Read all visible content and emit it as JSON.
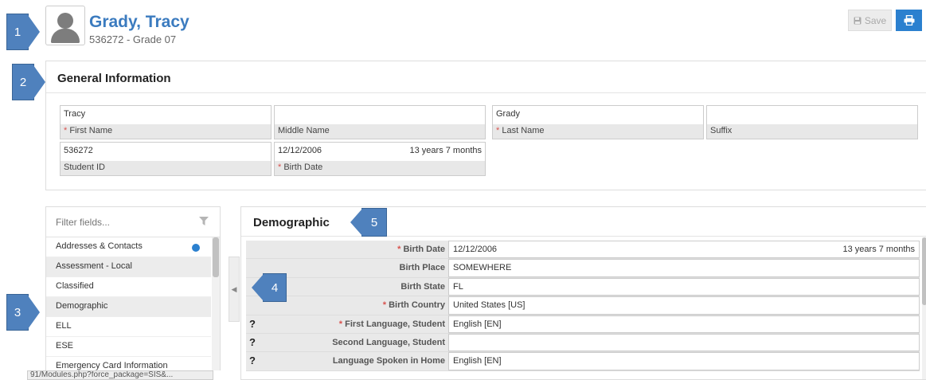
{
  "student": {
    "name": "Grady, Tracy",
    "subtitle": "536272 - Grade 07"
  },
  "toolbar": {
    "save_label": "Save"
  },
  "callouts": [
    "1",
    "2",
    "3",
    "4",
    "5"
  ],
  "general": {
    "title": "General Information",
    "fields": {
      "first_name": {
        "value": "Tracy",
        "label": "First Name"
      },
      "middle_name": {
        "value": "",
        "label": "Middle Name"
      },
      "last_name": {
        "value": "Grady",
        "label": "Last Name"
      },
      "suffix": {
        "value": "",
        "label": "Suffix"
      },
      "student_id": {
        "value": "536272",
        "label": "Student ID"
      },
      "birth_date": {
        "value": "12/12/2006",
        "age": "13 years 7 months",
        "label": "Birth Date"
      }
    }
  },
  "sidebar": {
    "filter_placeholder": "Filter fields...",
    "items": [
      {
        "label": "Addresses & Contacts"
      },
      {
        "label": "Assessment - Local"
      },
      {
        "label": "Classified"
      },
      {
        "label": "Demographic"
      },
      {
        "label": "ELL"
      },
      {
        "label": "ESE"
      },
      {
        "label": "Emergency Card Information"
      }
    ]
  },
  "status_url": "91/Modules.php?force_package=SIS&...",
  "demographic": {
    "title": "Demographic",
    "rows": [
      {
        "label": "Birth Date",
        "value": "12/12/2006",
        "extra": "13 years 7 months"
      },
      {
        "label": "Birth Place",
        "value": "SOMEWHERE"
      },
      {
        "label": "Birth State",
        "value": "FL"
      },
      {
        "label": "Birth Country",
        "value": "United States [US]"
      },
      {
        "label": "First Language, Student",
        "value": "English [EN]"
      },
      {
        "label": "Second Language, Student",
        "value": ""
      },
      {
        "label": "Language Spoken in Home",
        "value": "English [EN]"
      }
    ]
  },
  "colors": {
    "accent": "#2b80cf",
    "name": "#3b7bbf",
    "callout": "#4f81bd",
    "required": "#d9534f"
  },
  "icons": [
    "person-avatar-icon",
    "floppy-disk-icon",
    "printer-icon",
    "filter-funnel-icon",
    "caret-left-icon",
    "question-mark-icon",
    "blue-dot-icon"
  ]
}
